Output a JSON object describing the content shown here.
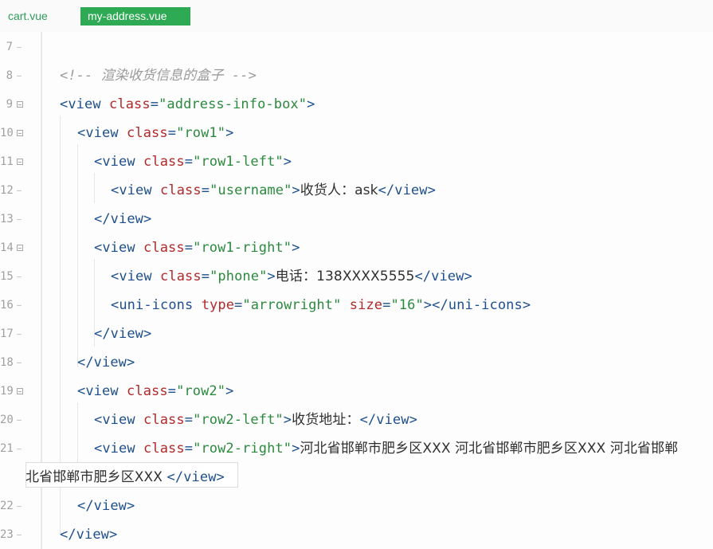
{
  "tabs": [
    {
      "label": "cart.vue",
      "active": false
    },
    {
      "label": "my-address.vue",
      "active": true
    }
  ],
  "colors": {
    "active_tab": "#2faa54",
    "tag": "#1d4f8e",
    "attribute": "#b02a2a",
    "string": "#2b8a3e",
    "comment": "#9a9a9a"
  },
  "lines": [
    {
      "n": "7"
    },
    {
      "n": "8",
      "comment": "<!-- 渲染收货信息的盒子 -->"
    },
    {
      "n": "9",
      "open": "<view",
      "attr": "class",
      "eq": "=",
      "val": "\"address-info-box\"",
      "close": ">"
    },
    {
      "n": "10",
      "open": "<view",
      "attr": "class",
      "eq": "=",
      "val": "\"row1\"",
      "close": ">"
    },
    {
      "n": "11",
      "open": "<view",
      "attr": "class",
      "eq": "=",
      "val": "\"row1-left\"",
      "close": ">"
    },
    {
      "n": "12",
      "open": "<view",
      "attr": "class",
      "eq": "=",
      "val": "\"username\"",
      "close": ">",
      "text": "收货人：ask",
      "end": "</view>"
    },
    {
      "n": "13",
      "end": "</view>"
    },
    {
      "n": "14",
      "open": "<view",
      "attr": "class",
      "eq": "=",
      "val": "\"row1-right\"",
      "close": ">"
    },
    {
      "n": "15",
      "open": "<view",
      "attr": "class",
      "eq": "=",
      "val": "\"phone\"",
      "close": ">",
      "text": "电话：138XXXX5555",
      "end": "</view>"
    },
    {
      "n": "16",
      "open": "<uni-icons",
      "attr": "type",
      "eq": "=",
      "val": "\"arrowright\"",
      "attr2": "size",
      "eq2": "=",
      "val2": "\"16\"",
      "close": ">",
      "end": "</uni-icons>"
    },
    {
      "n": "17",
      "end": "</view>"
    },
    {
      "n": "18",
      "end": "</view>"
    },
    {
      "n": "19",
      "open": "<view",
      "attr": "class",
      "eq": "=",
      "val": "\"row2\"",
      "close": ">"
    },
    {
      "n": "20",
      "open": "<view",
      "attr": "class",
      "eq": "=",
      "val": "\"row2-left\"",
      "close": ">",
      "text": "收货地址：",
      "end": "</view>"
    },
    {
      "n": "21",
      "open": "<view",
      "attr": "class",
      "eq": "=",
      "val": "\"row2-right\"",
      "close": ">",
      "text": "河北省邯郸市肥乡区XXX 河北省邯郸市肥乡区XXX 河北省邯郸"
    },
    {
      "n": "",
      "wraptext": "北省邯郸市肥乡区XXX ",
      "end": "</view>"
    },
    {
      "n": "22",
      "end": "</view>"
    },
    {
      "n": "23",
      "end": "</view>"
    }
  ]
}
